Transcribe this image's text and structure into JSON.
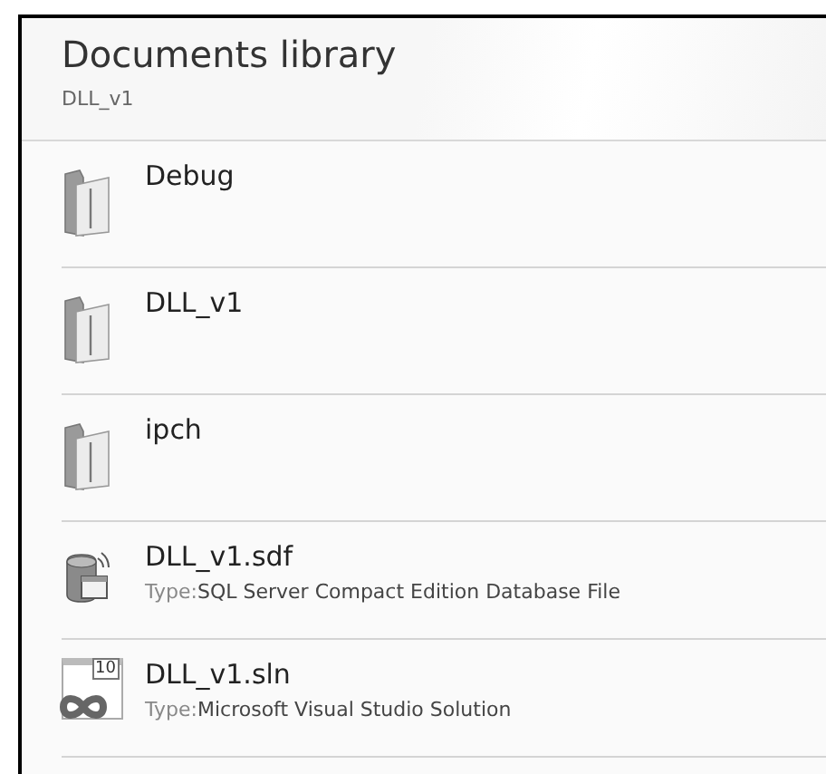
{
  "header": {
    "title": "Documents library",
    "subtitle": "DLL_v1"
  },
  "items": [
    {
      "kind": "folder",
      "name": "Debug"
    },
    {
      "kind": "folder",
      "name": "DLL_v1"
    },
    {
      "kind": "folder",
      "name": "ipch"
    },
    {
      "kind": "database",
      "name": "DLL_v1.sdf",
      "type_label": "Type:",
      "type": "SQL Server Compact Edition Database File"
    },
    {
      "kind": "solution",
      "name": "DLL_v1.sln",
      "badge": "10",
      "type_label": "Type:",
      "type": "Microsoft Visual Studio Solution"
    }
  ]
}
